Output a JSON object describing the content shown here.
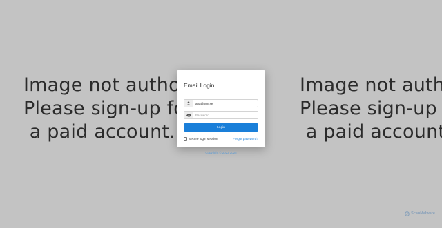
{
  "background": {
    "message_lines": "Image not author\nPlease sign-up for\n a paid account.",
    "message_lines_right": "Image not autho\nPlease sign-up fo\n a paid account."
  },
  "login": {
    "title": "Email Login",
    "email_value": "apa@son.se",
    "password_placeholder": "Password",
    "login_button": "Login",
    "secure_label": "Secure login session",
    "forgot_link": "Forgot password?",
    "copyright": "Copyright © 2023 2025"
  },
  "watermark": {
    "text": "ScanMalware"
  },
  "colors": {
    "background": "#c3c3c3",
    "accent": "#1a7fd9",
    "card": "#ffffff"
  },
  "icons": {
    "email_addon": "user-icon",
    "password_addon": "eye-icon",
    "watermark": "scan-logo-icon"
  }
}
